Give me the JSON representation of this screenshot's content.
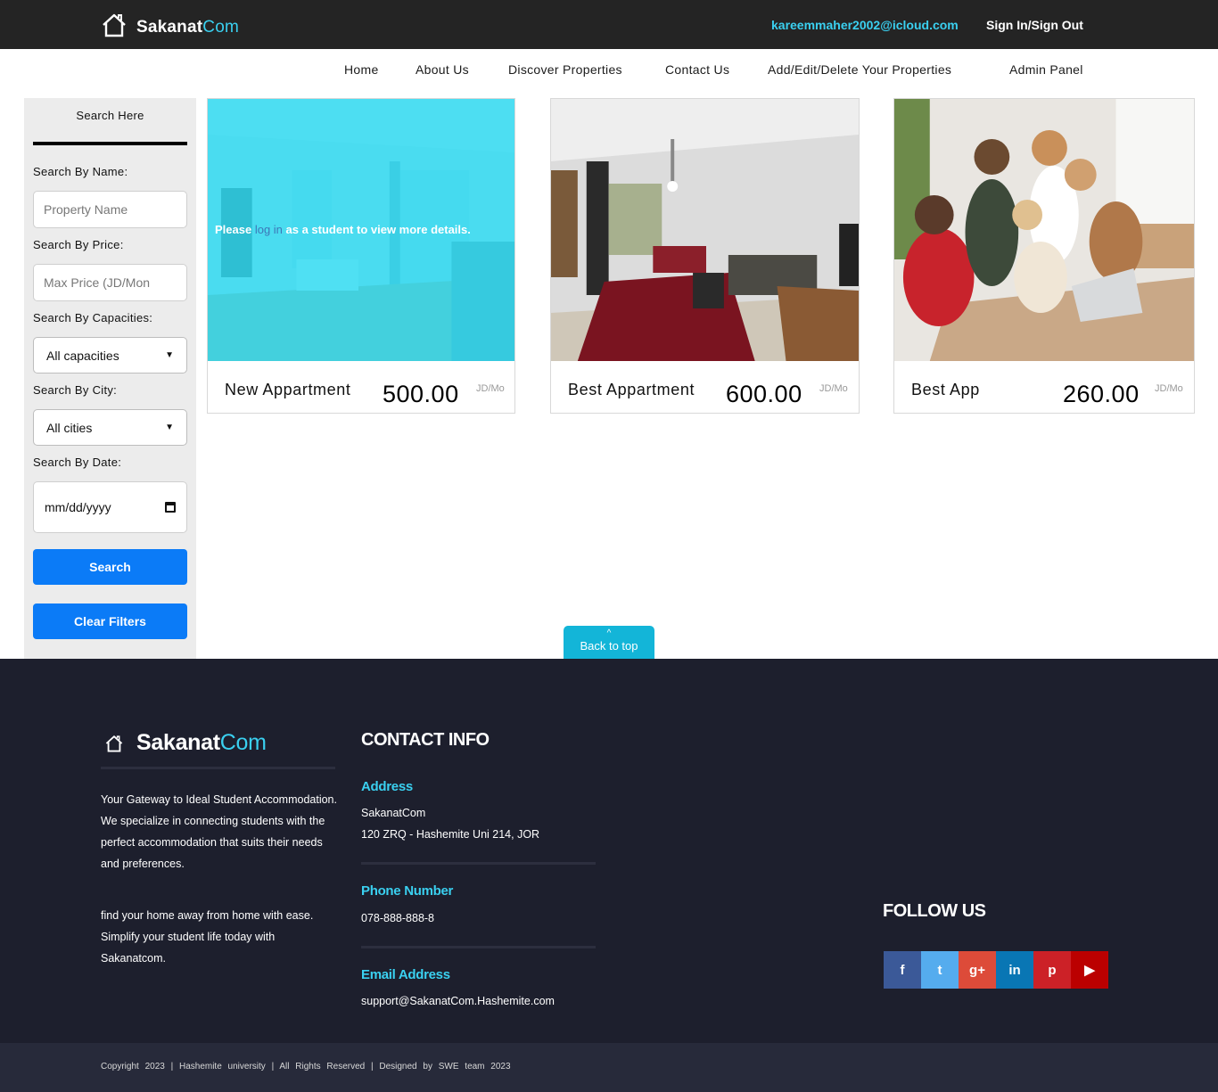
{
  "header": {
    "logo_main": "Sakanat",
    "logo_accent": "Com",
    "user_email": "kareemmaher2002@icloud.com",
    "sign_in_out": "Sign In/Sign Out"
  },
  "nav": {
    "items": [
      "Home",
      "About Us",
      "Discover Properties",
      "Contact Us",
      "Add/Edit/Delete Your Properties",
      "Admin Panel"
    ]
  },
  "sidebar": {
    "title": "Search Here",
    "name_label": "Search By Name:",
    "name_placeholder": "Property Name",
    "price_label": "Search By Price:",
    "price_placeholder": "Max Price (JD/Mon",
    "capacity_label": "Search By Capacities:",
    "capacity_selected": "All capacities",
    "city_label": "Search By City:",
    "city_selected": "All cities",
    "date_label": "Search By Date:",
    "date_placeholder": "mm/dd/yyyy",
    "search_button": "Search",
    "clear_button": "Clear Filters"
  },
  "listings": [
    {
      "name": "New Appartment",
      "price": "500.00",
      "unit": "JD/Mo",
      "overlay_pre": "Please ",
      "overlay_link": "log in",
      "overlay_post": " as a student to view more details."
    },
    {
      "name": "Best Appartment",
      "price": "600.00",
      "unit": "JD/Mo"
    },
    {
      "name": "Best App",
      "price": "260.00",
      "unit": "JD/Mo"
    }
  ],
  "back_to_top": {
    "caret": "^",
    "label": "Back to top"
  },
  "footer": {
    "logo_main": "Sakanat",
    "logo_accent": "Com",
    "about_1": "Your Gateway to Ideal Student Accommodation. We specialize in connecting students with the perfect accommodation that suits their needs and preferences.",
    "about_2": "find your home away from home with ease. Simplify your student life today with Sakanatcom.",
    "contact_heading": "CONTACT INFO",
    "address_title": "Address",
    "address_line1": "SakanatCom",
    "address_line2": "120 ZRQ - Hashemite Uni 214, JOR",
    "phone_title": "Phone Number",
    "phone": "078-888-888-8",
    "email_title": "Email Address",
    "email": "support@SakanatCom.Hashemite.com",
    "follow_heading": "FOLLOW US",
    "socials": [
      {
        "name": "facebook-icon",
        "glyph": "f",
        "color": "#3b5998"
      },
      {
        "name": "twitter-icon",
        "glyph": "t",
        "color": "#55acee"
      },
      {
        "name": "google-plus-icon",
        "glyph": "g+",
        "color": "#dd4b39"
      },
      {
        "name": "linkedin-icon",
        "glyph": "in",
        "color": "#0976b4"
      },
      {
        "name": "pinterest-icon",
        "glyph": "p",
        "color": "#cc2127"
      },
      {
        "name": "youtube-icon",
        "glyph": "▶",
        "color": "#b00"
      }
    ],
    "copyright": "Copyright 2023 | Hashemite university | All Rights Reserved | Designed by SWE team 2023"
  }
}
